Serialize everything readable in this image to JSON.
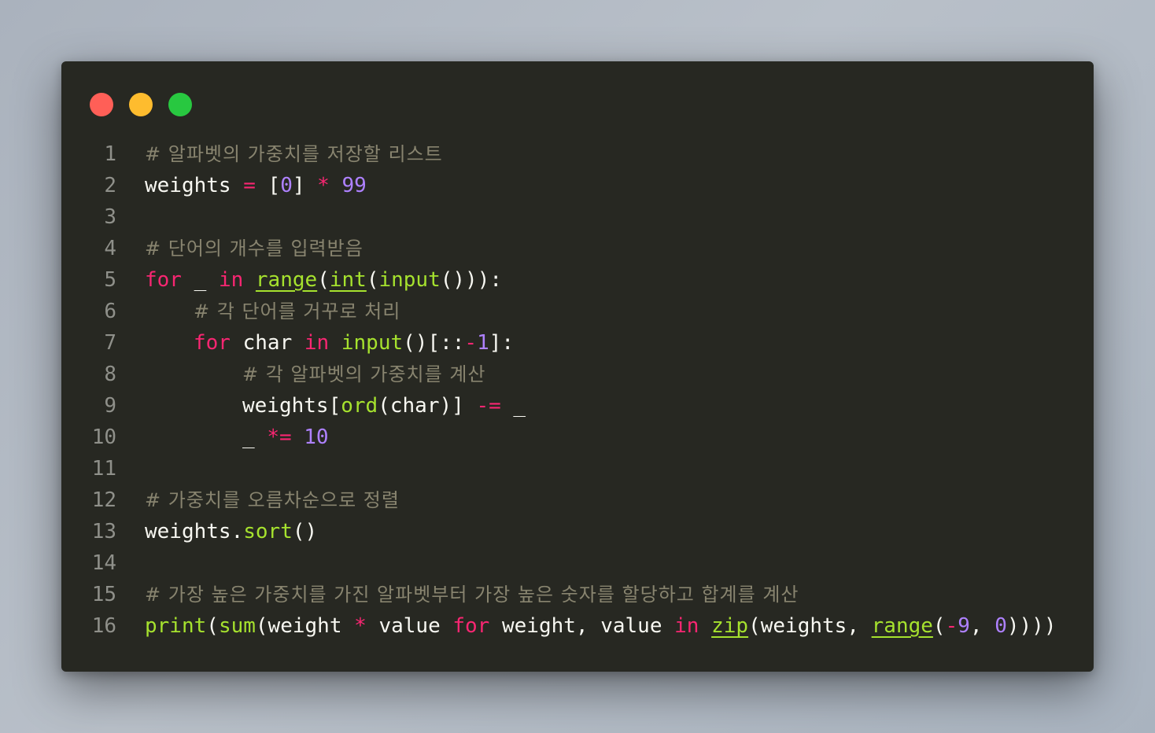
{
  "window": {
    "buttons": [
      {
        "name": "close",
        "color": "#ff5f57"
      },
      {
        "name": "minimize",
        "color": "#febc2e"
      },
      {
        "name": "maximize",
        "color": "#28c840"
      }
    ]
  },
  "colors": {
    "background": "#272822",
    "comment": "#88846f",
    "keyword": "#f92672",
    "number": "#ae81ff",
    "function": "#a6e22e",
    "text": "#f8f8f2",
    "line_number": "#8f908a"
  },
  "code": {
    "lines": [
      {
        "n": "1",
        "indent": 0,
        "tokens": [
          {
            "t": "# 알파벳의 가중치를 저장할 리스트",
            "k": "comment"
          }
        ]
      },
      {
        "n": "2",
        "indent": 0,
        "tokens": [
          {
            "t": "weights ",
            "k": "plain"
          },
          {
            "t": "=",
            "k": "op"
          },
          {
            "t": " [",
            "k": "plain"
          },
          {
            "t": "0",
            "k": "num"
          },
          {
            "t": "] ",
            "k": "plain"
          },
          {
            "t": "*",
            "k": "op"
          },
          {
            "t": " ",
            "k": "plain"
          },
          {
            "t": "99",
            "k": "num"
          }
        ]
      },
      {
        "n": "3",
        "indent": 0,
        "tokens": []
      },
      {
        "n": "4",
        "indent": 0,
        "tokens": [
          {
            "t": "# 단어의 개수를 입력받음",
            "k": "comment"
          }
        ]
      },
      {
        "n": "5",
        "indent": 0,
        "tokens": [
          {
            "t": "for",
            "k": "kw"
          },
          {
            "t": " _ ",
            "k": "plain"
          },
          {
            "t": "in",
            "k": "kw"
          },
          {
            "t": " ",
            "k": "plain"
          },
          {
            "t": "range",
            "k": "fnu"
          },
          {
            "t": "(",
            "k": "plain"
          },
          {
            "t": "int",
            "k": "fnu"
          },
          {
            "t": "(",
            "k": "plain"
          },
          {
            "t": "input",
            "k": "fn"
          },
          {
            "t": "())):",
            "k": "plain"
          }
        ]
      },
      {
        "n": "6",
        "indent": 1,
        "tokens": [
          {
            "t": "# 각 단어를 거꾸로 처리",
            "k": "comment"
          }
        ]
      },
      {
        "n": "7",
        "indent": 1,
        "tokens": [
          {
            "t": "for",
            "k": "kw"
          },
          {
            "t": " char ",
            "k": "plain"
          },
          {
            "t": "in",
            "k": "kw"
          },
          {
            "t": " ",
            "k": "plain"
          },
          {
            "t": "input",
            "k": "fn"
          },
          {
            "t": "()[::",
            "k": "plain"
          },
          {
            "t": "-",
            "k": "op"
          },
          {
            "t": "1",
            "k": "num"
          },
          {
            "t": "]:",
            "k": "plain"
          }
        ]
      },
      {
        "n": "8",
        "indent": 2,
        "tokens": [
          {
            "t": "# 각 알파벳의 가중치를 계산",
            "k": "comment"
          }
        ]
      },
      {
        "n": "9",
        "indent": 2,
        "tokens": [
          {
            "t": "weights[",
            "k": "plain"
          },
          {
            "t": "ord",
            "k": "fn"
          },
          {
            "t": "(char)] ",
            "k": "plain"
          },
          {
            "t": "-=",
            "k": "op"
          },
          {
            "t": " _",
            "k": "plain"
          }
        ]
      },
      {
        "n": "10",
        "indent": 2,
        "tokens": [
          {
            "t": "_ ",
            "k": "plain"
          },
          {
            "t": "*=",
            "k": "op"
          },
          {
            "t": " ",
            "k": "plain"
          },
          {
            "t": "10",
            "k": "num"
          }
        ]
      },
      {
        "n": "11",
        "indent": 0,
        "tokens": []
      },
      {
        "n": "12",
        "indent": 0,
        "tokens": [
          {
            "t": "# 가중치를 오름차순으로 정렬",
            "k": "comment"
          }
        ]
      },
      {
        "n": "13",
        "indent": 0,
        "tokens": [
          {
            "t": "weights.",
            "k": "plain"
          },
          {
            "t": "sort",
            "k": "fn"
          },
          {
            "t": "()",
            "k": "plain"
          }
        ]
      },
      {
        "n": "14",
        "indent": 0,
        "tokens": []
      },
      {
        "n": "15",
        "indent": 0,
        "tokens": [
          {
            "t": "# 가장 높은 가중치를 가진 알파벳부터 가장 높은 숫자를 할당하고 합계를 계산",
            "k": "comment"
          }
        ]
      },
      {
        "n": "16",
        "indent": 0,
        "tokens": [
          {
            "t": "print",
            "k": "fn"
          },
          {
            "t": "(",
            "k": "plain"
          },
          {
            "t": "sum",
            "k": "fn"
          },
          {
            "t": "(weight ",
            "k": "plain"
          },
          {
            "t": "*",
            "k": "op"
          },
          {
            "t": " value ",
            "k": "plain"
          },
          {
            "t": "for",
            "k": "kw"
          },
          {
            "t": " weight, value ",
            "k": "plain"
          },
          {
            "t": "in",
            "k": "kw"
          },
          {
            "t": " ",
            "k": "plain"
          },
          {
            "t": "zip",
            "k": "fnu"
          },
          {
            "t": "(weights, ",
            "k": "plain"
          },
          {
            "t": "range",
            "k": "fnu"
          },
          {
            "t": "(",
            "k": "plain"
          },
          {
            "t": "-",
            "k": "op"
          },
          {
            "t": "9",
            "k": "num"
          },
          {
            "t": ", ",
            "k": "plain"
          },
          {
            "t": "0",
            "k": "num"
          },
          {
            "t": ")))) ",
            "k": "plain"
          }
        ]
      }
    ]
  }
}
